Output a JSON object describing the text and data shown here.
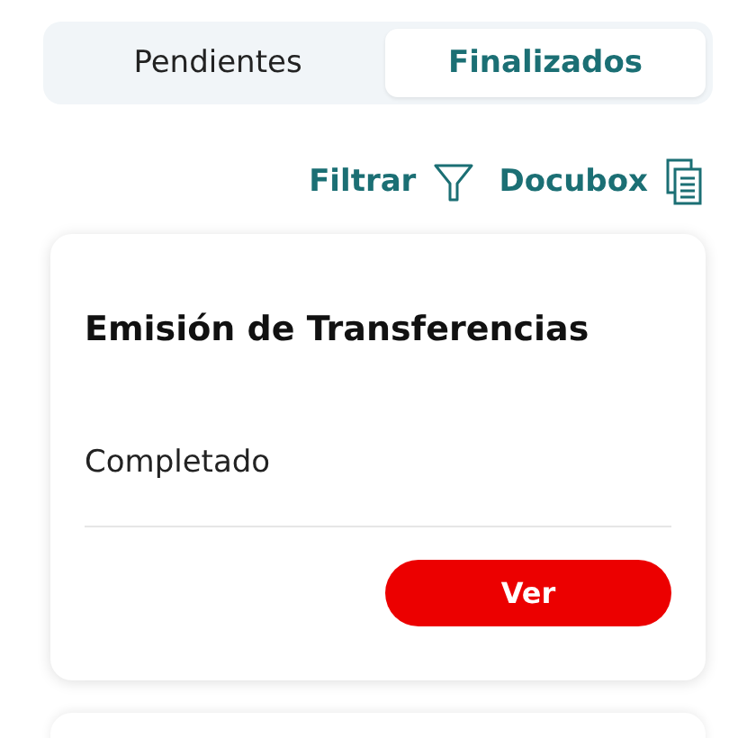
{
  "tabs": [
    {
      "label": "Pendientes",
      "selected": false
    },
    {
      "label": "Finalizados",
      "selected": true
    }
  ],
  "actions": [
    {
      "label": "Filtrar",
      "kind": "filter"
    },
    {
      "label": "Docubox",
      "kind": "documents"
    }
  ],
  "cards": [
    {
      "title": "Emisión de Transferencias",
      "status": "Completado",
      "button": "Ver"
    }
  ]
}
